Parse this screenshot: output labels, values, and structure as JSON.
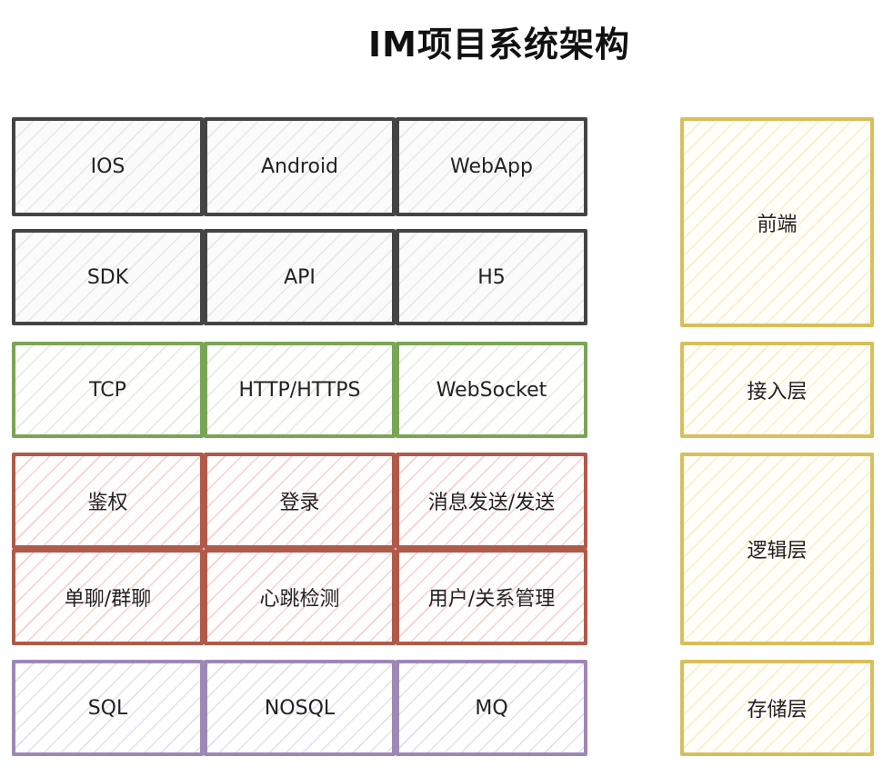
{
  "title": "IM项目系统架构",
  "colors": {
    "front": "#444444",
    "access": "#7aa557",
    "logic": "#b05a4a",
    "storage": "#9d88b6",
    "label": "#d9bf5a"
  },
  "rows": {
    "clients": [
      "IOS",
      "Android",
      "WebApp"
    ],
    "interfaces": [
      "SDK",
      "API",
      "H5"
    ],
    "protocols": [
      "TCP",
      "HTTP/HTTPS",
      "WebSocket"
    ],
    "logic_1": [
      "鉴权",
      "登录",
      "消息发送/发送"
    ],
    "logic_2": [
      "单聊/群聊",
      "心跳检测",
      "用户/关系管理"
    ],
    "storage": [
      "SQL",
      "NOSQL",
      "MQ"
    ]
  },
  "layers": [
    "前端",
    "接入层",
    "逻辑层",
    "存储层"
  ]
}
